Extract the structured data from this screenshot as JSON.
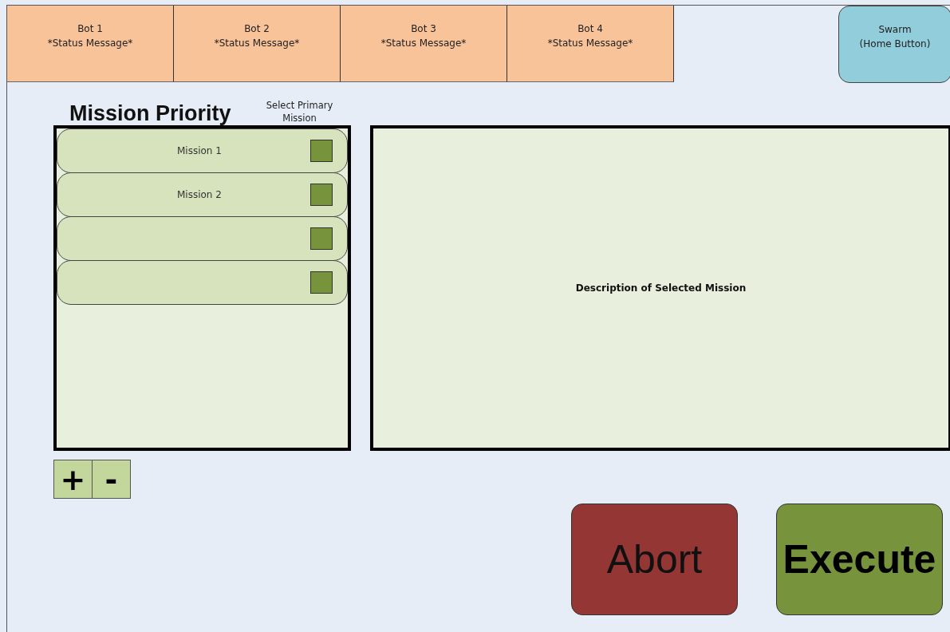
{
  "bots": [
    {
      "name": "Bot 1",
      "status": "*Status Message*"
    },
    {
      "name": "Bot 2",
      "status": "*Status Message*"
    },
    {
      "name": "Bot 3",
      "status": "*Status Message*"
    },
    {
      "name": "Bot 4",
      "status": "*Status Message*"
    }
  ],
  "home_button": {
    "title": "Swarm",
    "subtitle": "(Home Button)"
  },
  "mission_priority": {
    "title": "Mission Priority",
    "select_label": "Select Primary Mission",
    "missions": [
      {
        "label": "Mission 1",
        "checked": false
      },
      {
        "label": "Mission 2",
        "checked": false
      },
      {
        "checked": false
      },
      {
        "checked": false
      }
    ]
  },
  "list_buttons": [
    "+",
    "-"
  ],
  "description": "Description of Selected Mission",
  "actions": [
    {
      "kind": "abort",
      "label": "Abort"
    },
    {
      "kind": "execute",
      "label": "Execute"
    }
  ]
}
